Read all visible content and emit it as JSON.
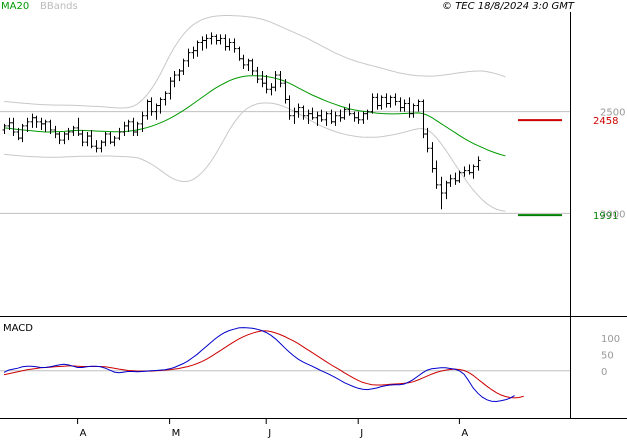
{
  "header": {
    "legend_ma": "MA20",
    "legend_bb": "BBands",
    "copyright": "© TEC 18/8/2024 3:0 GMT"
  },
  "price_axis": {
    "ticks": [
      {
        "value": 2500,
        "label": "2500"
      },
      {
        "value": 2000,
        "label": "2000"
      }
    ]
  },
  "levels": {
    "resistance": {
      "value": 2458,
      "label": "2458",
      "color": "#cc0000"
    },
    "support": {
      "value": 1991,
      "label": "1991",
      "color": "#008000"
    }
  },
  "macd": {
    "label": "MACD",
    "ticks": [
      {
        "value": 100,
        "label": "100"
      },
      {
        "value": 50,
        "label": "50"
      },
      {
        "value": 0,
        "label": "0"
      }
    ]
  },
  "x_axis": {
    "months": [
      {
        "label": "A",
        "index": 16
      },
      {
        "label": "M",
        "index": 36
      },
      {
        "label": "J",
        "index": 57
      },
      {
        "label": "J",
        "index": 77
      },
      {
        "label": "A",
        "index": 99
      }
    ]
  },
  "colors": {
    "candle": "#000000",
    "ma20": "#009900",
    "bbands": "#c8c8c8",
    "macd_line": "#0000cc",
    "signal_line": "#cc0000",
    "grid": "#c0c0c0"
  },
  "chart_data": [
    {
      "type": "candlestick",
      "title": "",
      "ylabel": "",
      "ylim": [
        1500,
        2990
      ],
      "x_count": 110,
      "ohlc": [
        [
          2410,
          2440,
          2390,
          2430
        ],
        [
          2430,
          2470,
          2410,
          2445
        ],
        [
          2445,
          2470,
          2380,
          2400
        ],
        [
          2400,
          2420,
          2360,
          2370
        ],
        [
          2370,
          2440,
          2350,
          2430
        ],
        [
          2430,
          2470,
          2400,
          2450
        ],
        [
          2450,
          2490,
          2420,
          2470
        ],
        [
          2470,
          2480,
          2420,
          2450
        ],
        [
          2450,
          2470,
          2410,
          2440
        ],
        [
          2440,
          2460,
          2400,
          2450
        ],
        [
          2450,
          2460,
          2390,
          2410
        ],
        [
          2410,
          2430,
          2370,
          2390
        ],
        [
          2390,
          2400,
          2340,
          2360
        ],
        [
          2360,
          2400,
          2340,
          2390
        ],
        [
          2390,
          2420,
          2360,
          2400
        ],
        [
          2400,
          2430,
          2380,
          2420
        ],
        [
          2420,
          2470,
          2380,
          2390
        ],
        [
          2390,
          2410,
          2330,
          2350
        ],
        [
          2350,
          2400,
          2330,
          2380
        ],
        [
          2380,
          2410,
          2320,
          2330
        ],
        [
          2330,
          2360,
          2300,
          2320
        ],
        [
          2320,
          2360,
          2300,
          2350
        ],
        [
          2350,
          2400,
          2330,
          2390
        ],
        [
          2390,
          2400,
          2340,
          2350
        ],
        [
          2350,
          2380,
          2330,
          2370
        ],
        [
          2370,
          2420,
          2360,
          2400
        ],
        [
          2400,
          2450,
          2380,
          2430
        ],
        [
          2430,
          2460,
          2400,
          2450
        ],
        [
          2450,
          2470,
          2380,
          2400
        ],
        [
          2400,
          2450,
          2380,
          2440
        ],
        [
          2440,
          2500,
          2400,
          2480
        ],
        [
          2480,
          2560,
          2460,
          2550
        ],
        [
          2550,
          2570,
          2480,
          2500
        ],
        [
          2500,
          2540,
          2460,
          2530
        ],
        [
          2530,
          2570,
          2490,
          2560
        ],
        [
          2560,
          2600,
          2530,
          2590
        ],
        [
          2590,
          2670,
          2560,
          2650
        ],
        [
          2650,
          2700,
          2620,
          2680
        ],
        [
          2680,
          2710,
          2650,
          2700
        ],
        [
          2700,
          2760,
          2680,
          2750
        ],
        [
          2750,
          2810,
          2720,
          2790
        ],
        [
          2790,
          2820,
          2760,
          2800
        ],
        [
          2800,
          2850,
          2770,
          2840
        ],
        [
          2840,
          2870,
          2800,
          2850
        ],
        [
          2850,
          2880,
          2810,
          2860
        ],
        [
          2860,
          2890,
          2830,
          2870
        ],
        [
          2870,
          2880,
          2830,
          2850
        ],
        [
          2850,
          2880,
          2830,
          2860
        ],
        [
          2860,
          2880,
          2800,
          2820
        ],
        [
          2820,
          2860,
          2800,
          2840
        ],
        [
          2840,
          2860,
          2790,
          2810
        ],
        [
          2810,
          2820,
          2750,
          2760
        ],
        [
          2760,
          2780,
          2710,
          2730
        ],
        [
          2730,
          2760,
          2700,
          2750
        ],
        [
          2750,
          2760,
          2680,
          2700
        ],
        [
          2700,
          2720,
          2640,
          2660
        ],
        [
          2660,
          2700,
          2620,
          2640
        ],
        [
          2640,
          2680,
          2590,
          2610
        ],
        [
          2610,
          2640,
          2580,
          2620
        ],
        [
          2620,
          2700,
          2600,
          2680
        ],
        [
          2680,
          2700,
          2620,
          2640
        ],
        [
          2640,
          2660,
          2540,
          2560
        ],
        [
          2560,
          2580,
          2460,
          2480
        ],
        [
          2480,
          2520,
          2440,
          2500
        ],
        [
          2500,
          2540,
          2470,
          2520
        ],
        [
          2520,
          2530,
          2460,
          2480
        ],
        [
          2480,
          2510,
          2440,
          2490
        ],
        [
          2490,
          2520,
          2460,
          2470
        ],
        [
          2470,
          2500,
          2430,
          2480
        ],
        [
          2480,
          2510,
          2450,
          2460
        ],
        [
          2460,
          2500,
          2430,
          2490
        ],
        [
          2490,
          2510,
          2440,
          2450
        ],
        [
          2450,
          2500,
          2430,
          2480
        ],
        [
          2480,
          2510,
          2450,
          2470
        ],
        [
          2470,
          2520,
          2460,
          2510
        ],
        [
          2510,
          2540,
          2480,
          2490
        ],
        [
          2490,
          2500,
          2450,
          2470
        ],
        [
          2470,
          2500,
          2440,
          2460
        ],
        [
          2460,
          2500,
          2440,
          2490
        ],
        [
          2490,
          2510,
          2460,
          2500
        ],
        [
          2500,
          2590,
          2490,
          2570
        ],
        [
          2570,
          2590,
          2510,
          2530
        ],
        [
          2530,
          2580,
          2510,
          2570
        ],
        [
          2570,
          2590,
          2520,
          2540
        ],
        [
          2540,
          2580,
          2520,
          2570
        ],
        [
          2570,
          2590,
          2530,
          2550
        ],
        [
          2550,
          2570,
          2500,
          2520
        ],
        [
          2520,
          2560,
          2500,
          2540
        ],
        [
          2540,
          2570,
          2470,
          2490
        ],
        [
          2490,
          2540,
          2470,
          2530
        ],
        [
          2530,
          2560,
          2500,
          2550
        ],
        [
          2550,
          2560,
          2370,
          2390
        ],
        [
          2390,
          2420,
          2300,
          2320
        ],
        [
          2320,
          2350,
          2200,
          2220
        ],
        [
          2220,
          2260,
          2120,
          2140
        ],
        [
          2140,
          2180,
          2020,
          2100
        ],
        [
          2100,
          2160,
          2070,
          2150
        ],
        [
          2150,
          2190,
          2130,
          2170
        ],
        [
          2170,
          2200,
          2140,
          2160
        ],
        [
          2160,
          2210,
          2150,
          2200
        ],
        [
          2200,
          2230,
          2180,
          2210
        ],
        [
          2210,
          2240,
          2190,
          2200
        ],
        [
          2200,
          2240,
          2170,
          2230
        ],
        [
          2230,
          2280,
          2210,
          2260
        ]
      ],
      "ma20": [
        2420,
        2418,
        2415,
        2412,
        2410,
        2408,
        2406,
        2404,
        2402,
        2400,
        2400,
        2401,
        2402,
        2403,
        2405,
        2407,
        2408,
        2408,
        2407,
        2406,
        2405,
        2404,
        2403,
        2402,
        2401,
        2401,
        2402,
        2404,
        2407,
        2410,
        2415,
        2421,
        2428,
        2436,
        2445,
        2455,
        2466,
        2478,
        2492,
        2506,
        2521,
        2537,
        2553,
        2569,
        2585,
        2601,
        2616,
        2629,
        2641,
        2652,
        2661,
        2668,
        2673,
        2676,
        2677,
        2677,
        2676,
        2673,
        2669,
        2664,
        2658,
        2650,
        2640,
        2629,
        2617,
        2605,
        2593,
        2582,
        2572,
        2562,
        2553,
        2544,
        2536,
        2528,
        2521,
        2514,
        2509,
        2505,
        2502,
        2499,
        2496,
        2493,
        2491,
        2490,
        2489,
        2489,
        2490,
        2491,
        2492,
        2493,
        2494,
        2491,
        2483,
        2471,
        2456,
        2441,
        2427,
        2412,
        2398,
        2383,
        2369,
        2356,
        2344,
        2333,
        2323,
        2313,
        2304,
        2296,
        2289,
        2283
      ],
      "bb_upper": [
        2550,
        2548,
        2546,
        2544,
        2542,
        2540,
        2538,
        2536,
        2535,
        2534,
        2533,
        2532,
        2532,
        2532,
        2531,
        2531,
        2530,
        2529,
        2528,
        2527,
        2526,
        2525,
        2523,
        2521,
        2519,
        2518,
        2518,
        2520,
        2526,
        2538,
        2556,
        2580,
        2610,
        2645,
        2685,
        2730,
        2775,
        2815,
        2850,
        2880,
        2905,
        2925,
        2940,
        2952,
        2960,
        2966,
        2970,
        2972,
        2973,
        2973,
        2972,
        2971,
        2969,
        2967,
        2964,
        2960,
        2955,
        2948,
        2940,
        2930,
        2920,
        2910,
        2900,
        2890,
        2880,
        2870,
        2860,
        2848,
        2836,
        2824,
        2812,
        2800,
        2789,
        2779,
        2769,
        2760,
        2752,
        2744,
        2738,
        2732,
        2726,
        2720,
        2714,
        2708,
        2702,
        2696,
        2690,
        2686,
        2682,
        2679,
        2677,
        2676,
        2675,
        2675,
        2676,
        2678,
        2681,
        2684,
        2688,
        2691,
        2694,
        2697,
        2699,
        2700,
        2700,
        2697,
        2692,
        2686,
        2679,
        2671
      ],
      "bb_lower": [
        2290,
        2288,
        2286,
        2284,
        2282,
        2280,
        2279,
        2278,
        2277,
        2276,
        2276,
        2276,
        2276,
        2277,
        2278,
        2279,
        2280,
        2281,
        2281,
        2281,
        2281,
        2282,
        2282,
        2282,
        2281,
        2280,
        2279,
        2278,
        2276,
        2273,
        2265,
        2255,
        2242,
        2228,
        2212,
        2195,
        2180,
        2168,
        2160,
        2156,
        2158,
        2165,
        2180,
        2200,
        2225,
        2255,
        2290,
        2330,
        2370,
        2410,
        2445,
        2475,
        2500,
        2518,
        2530,
        2538,
        2542,
        2543,
        2542,
        2538,
        2532,
        2524,
        2514,
        2503,
        2491,
        2478,
        2465,
        2452,
        2440,
        2429,
        2419,
        2410,
        2402,
        2395,
        2389,
        2384,
        2380,
        2377,
        2375,
        2374,
        2374,
        2375,
        2377,
        2380,
        2384,
        2388,
        2393,
        2399,
        2405,
        2411,
        2416,
        2417,
        2410,
        2395,
        2372,
        2344,
        2312,
        2278,
        2243,
        2209,
        2176,
        2144,
        2115,
        2089,
        2066,
        2047,
        2032,
        2021,
        2014,
        2010
      ]
    },
    {
      "type": "line",
      "title": "",
      "ylabel": "",
      "ylim": [
        -140,
        160
      ],
      "x_count": 110,
      "series": [
        {
          "name": "",
          "color": "#0000cc",
          "values": [
            -5,
            2,
            5,
            8,
            12,
            14,
            14,
            12,
            10,
            10,
            12,
            15,
            18,
            20,
            18,
            14,
            10,
            10,
            12,
            14,
            14,
            12,
            8,
            2,
            -4,
            -6,
            -4,
            -2,
            -2,
            -3,
            -2,
            -1,
            0,
            1,
            2,
            3,
            6,
            10,
            16,
            22,
            30,
            40,
            50,
            62,
            74,
            86,
            98,
            108,
            116,
            122,
            126,
            130,
            131,
            130,
            129,
            126,
            122,
            116,
            108,
            97,
            84,
            70,
            57,
            45,
            35,
            27,
            20,
            14,
            7,
            0,
            -6,
            -13,
            -20,
            -28,
            -36,
            -42,
            -48,
            -53,
            -56,
            -57,
            -55,
            -52,
            -48,
            -45,
            -43,
            -42,
            -42,
            -40,
            -34,
            -26,
            -16,
            -6,
            2,
            6,
            8,
            9,
            9,
            7,
            5,
            0,
            -10,
            -30,
            -52,
            -68,
            -80,
            -88,
            -92,
            -93,
            -91,
            -88,
            -83,
            -75
          ]
        },
        {
          "name": "",
          "color": "#cc0000",
          "values": [
            -12,
            -9,
            -6,
            -3,
            0,
            3,
            5,
            7,
            9,
            10,
            11,
            12,
            13,
            14,
            15,
            15,
            14,
            13,
            13,
            13,
            13,
            13,
            12,
            10,
            8,
            5,
            3,
            1,
            0,
            -1,
            -1,
            -1,
            -1,
            0,
            1,
            2,
            3,
            5,
            7,
            10,
            13,
            17,
            22,
            28,
            35,
            43,
            52,
            61,
            70,
            79,
            88,
            96,
            103,
            109,
            114,
            118,
            121,
            121,
            119,
            115,
            110,
            104,
            97,
            90,
            82,
            73,
            64,
            55,
            46,
            37,
            28,
            19,
            11,
            3,
            -6,
            -14,
            -22,
            -29,
            -35,
            -39,
            -42,
            -43,
            -43,
            -42,
            -41,
            -40,
            -39,
            -38,
            -36,
            -33,
            -28,
            -22,
            -16,
            -10,
            -5,
            -1,
            2,
            4,
            5,
            4,
            1,
            -5,
            -14,
            -25,
            -36,
            -47,
            -57,
            -66,
            -73,
            -78,
            -81,
            -82,
            -81,
            -77
          ]
        }
      ]
    }
  ]
}
